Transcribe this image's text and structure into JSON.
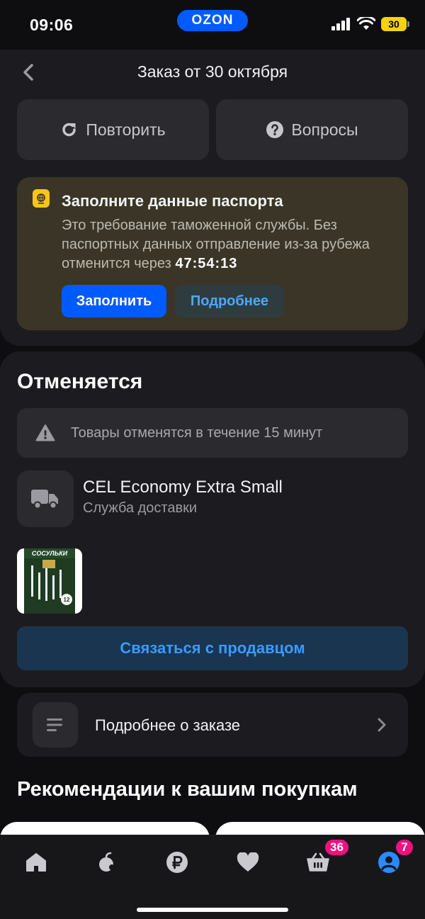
{
  "status_bar": {
    "time": "09:06",
    "brand": "OZON",
    "battery": "30"
  },
  "header": {
    "title": "Заказ от 30 октября"
  },
  "actions": {
    "repeat_label": "Повторить",
    "questions_label": "Вопросы"
  },
  "passport_notice": {
    "title": "Заполните данные паспорта",
    "text": "Это требование таможенной службы. Без паспортных данных отправление из-за рубежа отменится через",
    "countdown": "47:54:13",
    "fill_button": "Заполнить",
    "more_button": "Подробнее"
  },
  "order": {
    "status": "Отменяется",
    "warning": "Товары отменятся в течение 15 минут",
    "delivery_name": "CEL Economy Extra Small",
    "delivery_sub": "Служба доставки",
    "product_image_text": "СОСУЛЬКИ",
    "product_badge": "12",
    "contact_button": "Связаться с продавцом"
  },
  "details": {
    "label": "Подробнее о заказе"
  },
  "recommendations": {
    "title": "Рекомендации к вашим покупкам"
  },
  "tabbar": {
    "items": [
      "home",
      "fresh",
      "ozon-bank",
      "favorites",
      "cart",
      "profile"
    ],
    "cart_badge": "36",
    "profile_badge": "7",
    "active_color": "#2a8bff",
    "inactive_color": "#c9c9ce"
  },
  "colors": {
    "accent": "#005bff",
    "badge": "#f1117e",
    "passport_bg": "#3a3526"
  }
}
